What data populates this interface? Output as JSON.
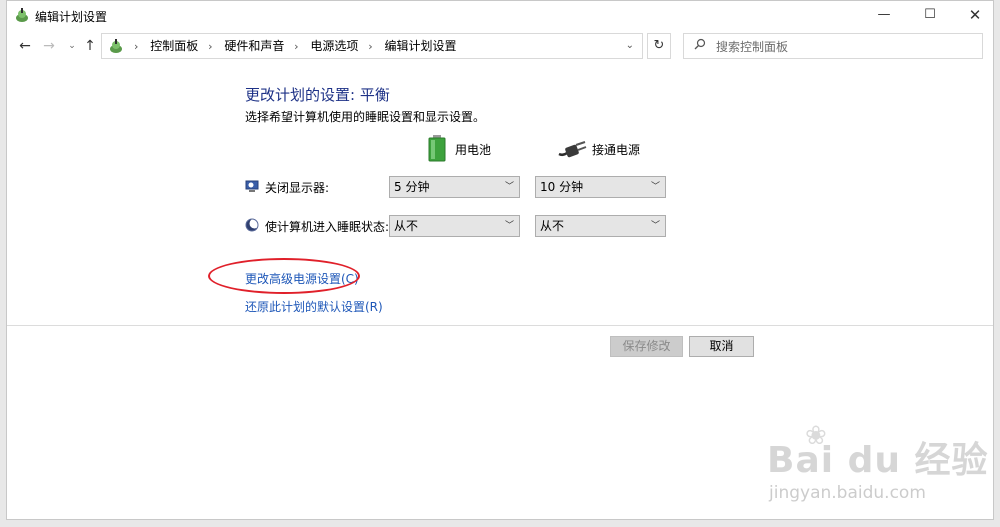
{
  "window": {
    "title": "编辑计划设置",
    "minimize_glyph": "—",
    "maximize_glyph": "☐",
    "close_glyph": "✕"
  },
  "nav": {
    "back_glyph": "←",
    "forward_glyph": "→",
    "recent_glyph": "⌄",
    "up_glyph": "↑",
    "breadcrumbs": [
      "控制面板",
      "硬件和声音",
      "电源选项",
      "编辑计划设置"
    ],
    "separator": "›",
    "dropdown_glyph": "⌄",
    "refresh_glyph": "↻"
  },
  "search": {
    "placeholder": "搜索控制面板",
    "icon": "search-icon"
  },
  "content": {
    "title": "更改计划的设置: 平衡",
    "description": "选择希望计算机使用的睡眠设置和显示设置。",
    "columns": {
      "battery": "用电池",
      "plugged_in": "接通电源"
    },
    "settings": [
      {
        "label": "关闭显示器:",
        "battery": "5 分钟",
        "plugged_in": "10 分钟",
        "icon": "monitor-icon"
      },
      {
        "label": "使计算机进入睡眠状态:",
        "battery": "从不",
        "plugged_in": "从不",
        "icon": "moon-icon"
      }
    ],
    "links": {
      "advanced": "更改高级电源设置(C)",
      "restore": "还原此计划的默认设置(R)"
    },
    "buttons": {
      "save": "保存修改",
      "cancel": "取消"
    }
  },
  "watermark": {
    "main": "Bai du 经验",
    "sub": "jingyan.baidu.com"
  },
  "colors": {
    "title_blue": "#1e3287",
    "link_blue": "#1e57b8",
    "annotation_red": "#e0202a"
  }
}
